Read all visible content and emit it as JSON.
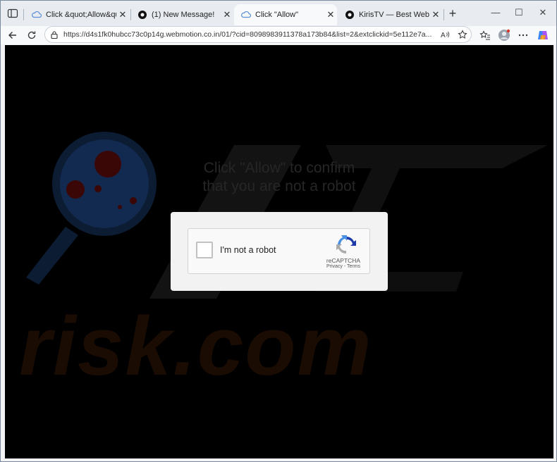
{
  "tabs": [
    {
      "label": "Click &quot;Allow&quot;",
      "icon": "cloud-icon",
      "active": false
    },
    {
      "label": "(1) New Message!",
      "icon": "circle-badge-icon",
      "active": false
    },
    {
      "label": "Click \"Allow\"",
      "icon": "cloud-icon",
      "active": true
    },
    {
      "label": "KirisTV — Best Website To",
      "icon": "circle-badge-icon",
      "active": false
    }
  ],
  "address_bar": {
    "url": "https://d4s1fk0hubcc73c0p14g.webmotion.co.in/01/?cid=8098983911378a173b84&list=2&extclickid=5e112e7a..."
  },
  "page": {
    "headline_line1": "Click \"Allow\" to confirm",
    "headline_line2": "that you are not a robot",
    "watermark_text": "risk.com"
  },
  "recaptcha": {
    "checkbox_label": "I'm not a robot",
    "brand": "reCAPTCHA",
    "privacy": "Privacy",
    "separator": " - ",
    "terms": "Terms"
  },
  "colors": {
    "page_background": "#000000",
    "headline": "#262626",
    "recaptcha_blue": "#4a90e2",
    "recaptcha_dark": "#1c3aa9"
  }
}
